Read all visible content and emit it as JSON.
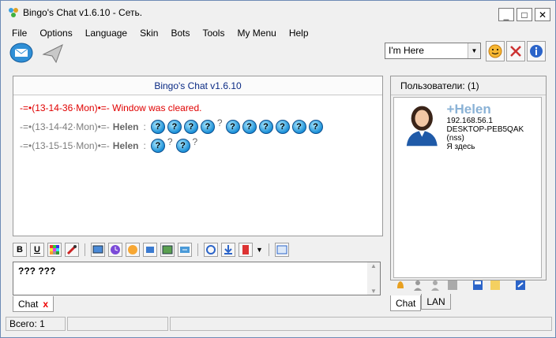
{
  "window": {
    "title": "Bingo's Chat v1.6.10 - Сеть.",
    "minimize": "_",
    "maximize": "□",
    "close": "✕"
  },
  "menu": [
    {
      "label": "File"
    },
    {
      "label": "Options"
    },
    {
      "label": "Language"
    },
    {
      "label": "Skin"
    },
    {
      "label": "Bots"
    },
    {
      "label": "Tools"
    },
    {
      "label": "My Menu"
    },
    {
      "label": "Help"
    }
  ],
  "toolbar": {
    "status_value": "I'm Here"
  },
  "chat": {
    "header": "Bingo's Chat v1.6.10",
    "messages": [
      {
        "prefix": "-=•(13-14-36·Mon)•=- Window was cleared."
      },
      {
        "prefix": "-=•(13-14-42·Mon)•=-",
        "user": "Helen",
        "sep": ":"
      },
      {
        "prefix": "-=•(13-15-15·Mon)•=-",
        "user": "Helen",
        "sep": ":"
      }
    ],
    "input_value": "??? ???"
  },
  "tabs_left": [
    {
      "label": "Chat",
      "close": "x"
    }
  ],
  "users": {
    "header": "Пользователи: (1)",
    "entries": [
      {
        "name": "+Helen",
        "ip": "192.168.56.1",
        "host": "DESKTOP-PEB5QAK (nss)",
        "status": "Я здесь"
      }
    ]
  },
  "tabs_right": [
    {
      "label": "Chat"
    },
    {
      "label": "LAN"
    }
  ],
  "statusbar": {
    "total": "Всего: 1"
  }
}
